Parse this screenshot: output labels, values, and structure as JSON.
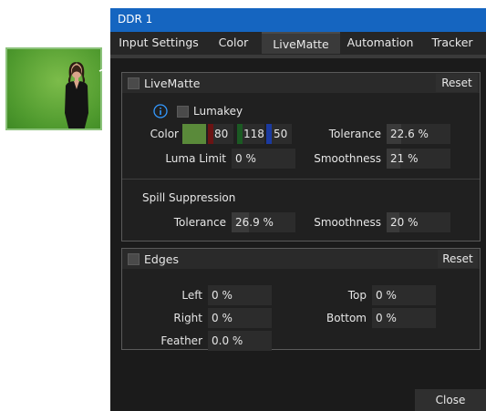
{
  "colors": {
    "title_bar": "#1565c0",
    "green_swatch": "#5a8a3a",
    "red_channel": "#5c1313",
    "green_channel": "#1b4d23",
    "blue_channel": "#1b3aa0",
    "info": "#3399ff"
  },
  "window": {
    "title": "DDR 1"
  },
  "tabs": [
    "Input Settings",
    "Color",
    "LiveMatte",
    "Automation",
    "Tracker"
  ],
  "active_tab": "LiveMatte",
  "livematte": {
    "title": "LiveMatte",
    "reset_label": "Reset",
    "lumakey_label": "Lumakey",
    "color_label": "Color",
    "color_r": "80",
    "color_g": "118",
    "color_b": "50",
    "tolerance_label": "Tolerance",
    "tolerance_value": "22.6 %",
    "tolerance_fraction": 0.226,
    "luma_limit_label": "Luma Limit",
    "luma_limit_value": "0 %",
    "luma_limit_fraction": 0.0,
    "smoothness_label": "Smoothness",
    "smoothness_value": "21 %",
    "smoothness_fraction": 0.21
  },
  "spill": {
    "title": "Spill Suppression",
    "tolerance_label": "Tolerance",
    "tolerance_value": "26.9 %",
    "tolerance_fraction": 0.269,
    "smoothness_label": "Smoothness",
    "smoothness_value": "20 %",
    "smoothness_fraction": 0.2
  },
  "edges": {
    "title": "Edges",
    "reset_label": "Reset",
    "left_label": "Left",
    "left_value": "0 %",
    "right_label": "Right",
    "right_value": "0 %",
    "feather_label": "Feather",
    "feather_value": "0.0 %",
    "top_label": "Top",
    "top_value": "0 %",
    "bottom_label": "Bottom",
    "bottom_value": "0 %"
  },
  "close_label": "Close"
}
